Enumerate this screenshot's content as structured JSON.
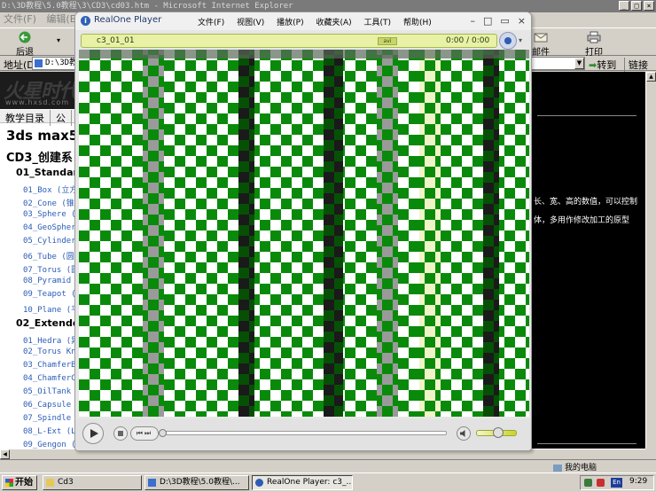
{
  "ie": {
    "title": "D:\\3D教程\\5.0教程\\3\\CD3\\cd03.htm - Microsoft Internet Explorer",
    "menu": [
      "文件(F)",
      "编辑(E)"
    ],
    "toolbar": {
      "back": "后退",
      "mail": "邮件",
      "print": "打印"
    },
    "address_label": "地址(D)",
    "address": "D:\\3D教程\\5.0教程\\3\\CD3\\cd03.htm",
    "go": "转到",
    "links": "链接",
    "status_zone": "我的电脑"
  },
  "page": {
    "logo": "火星时代",
    "logo_url": "www.hxsd.com",
    "nav": [
      "教学目录",
      "公"
    ],
    "course_title": "3ds max5",
    "chapter_title": "CD3_创建系",
    "sections": [
      {
        "title": "01_Standard",
        "lessons": [
          "01_Box (立方",
          "02_Cone (锥体",
          "03_Sphere (",
          "04_GeoSpher",
          "05_Cylinder",
          "06_Tube (圆管",
          "07_Torus (圆",
          "08_Pyramid (",
          "09_Teapot (",
          "10_Plane (平"
        ]
      },
      {
        "title": "02_Extendec",
        "lessons": [
          "01_Hedra (异",
          "02_Torus Kn",
          "03_ChamferB",
          "04_ChamferC",
          "05_OilTank (",
          "06_Capsule (",
          "07_Spindle (",
          "08_L-Ext (L",
          "09_Gengon ("
        ]
      }
    ],
    "desc_lines": [
      "长、宽、高的数值，可以控制",
      "体，多用作修改加工的原型"
    ]
  },
  "player": {
    "app_name": "RealOne Player",
    "menu": [
      "文件(F)",
      "视图(V)",
      "播放(P)",
      "收藏夹(A)",
      "工具(T)",
      "帮助(H)"
    ],
    "clip": "c3_01_01",
    "format": "avi",
    "time": "0:00 / 0:00",
    "seek_fraction": 0,
    "volume_fraction": 0.55
  },
  "taskbar": {
    "start": "开始",
    "tasks": [
      "Cd3",
      "D:\\3D教程\\5.0教程\\...",
      "RealOne Player: c3_..."
    ],
    "lang": "En",
    "clock": "9:29"
  },
  "colors": {
    "video_green": "#0a8a0a",
    "video_white": "#ffffff",
    "player_accent": "#e9f1a7"
  }
}
